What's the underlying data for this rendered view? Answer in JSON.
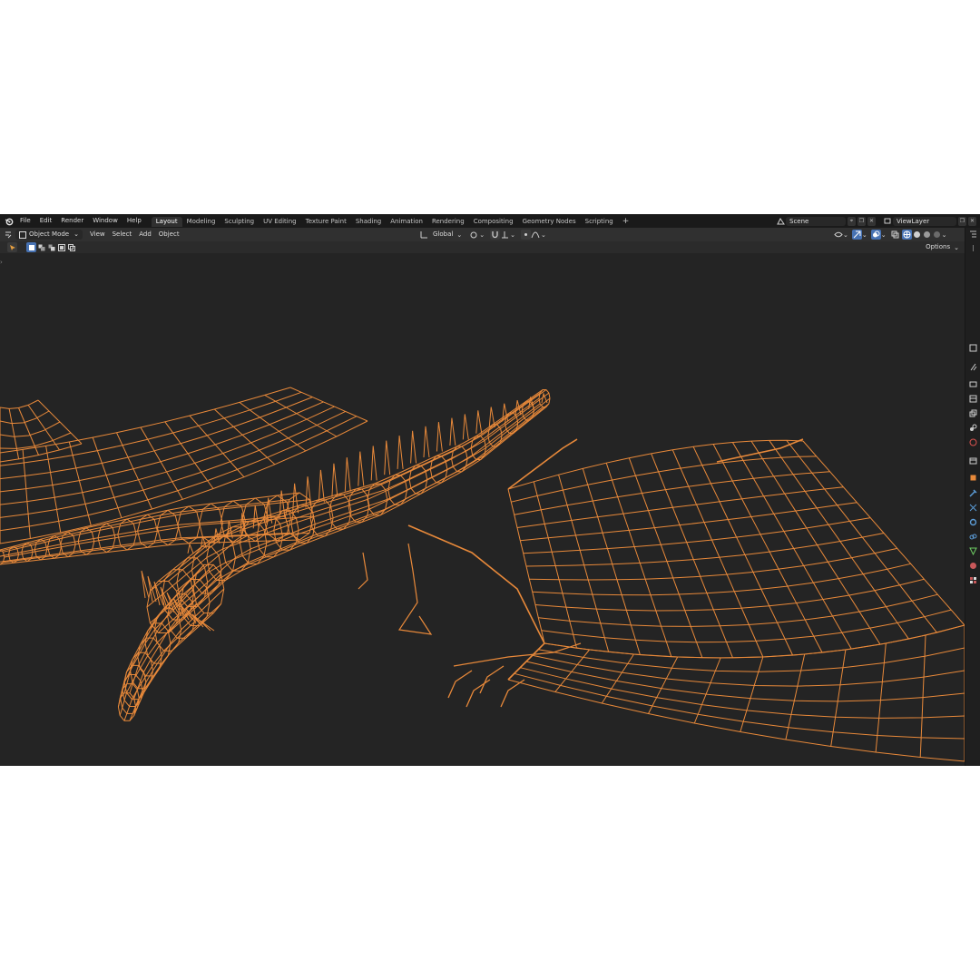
{
  "topbar": {
    "menus": [
      "File",
      "Edit",
      "Render",
      "Window",
      "Help"
    ],
    "workspaces": [
      "Layout",
      "Modeling",
      "Sculpting",
      "UV Editing",
      "Texture Paint",
      "Shading",
      "Animation",
      "Rendering",
      "Compositing",
      "Geometry Nodes",
      "Scripting"
    ],
    "active_workspace": "Layout",
    "add_tab": "+",
    "scene_name": "Scene",
    "view_layer_name": "ViewLayer"
  },
  "header": {
    "mode": "Object Mode",
    "menus": [
      "View",
      "Select",
      "Add",
      "Object"
    ],
    "orientation": "Global",
    "options": "Options"
  },
  "colors": {
    "wire": "#e8893a",
    "viewport_bg": "#242424",
    "topbar_bg": "#1a1a1a",
    "accent": "#4772b3"
  },
  "icons": {
    "blender_logo": "blender-logo-icon",
    "transform_pivot": "pivot-icon",
    "snap": "magnet-icon",
    "proportional": "proportional-edit-icon",
    "shading": "viewport-shading-icons"
  }
}
